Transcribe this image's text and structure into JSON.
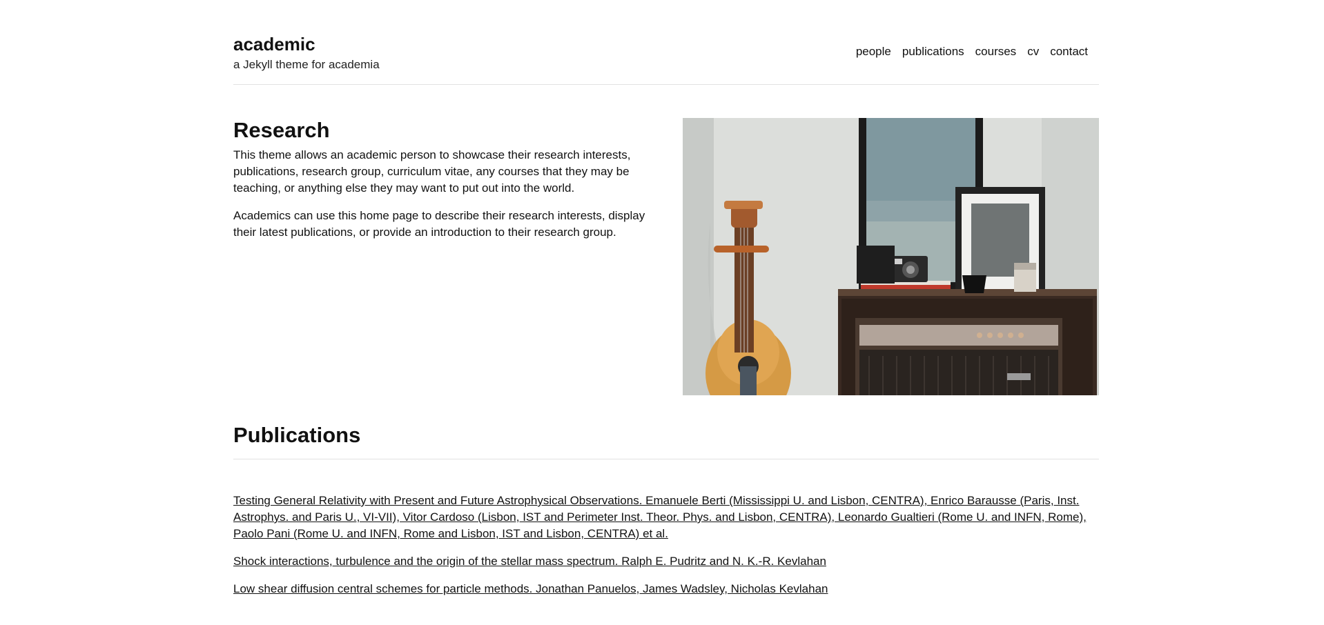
{
  "site": {
    "title": "academic",
    "tagline": "a Jekyll theme for academia",
    "nav": [
      "people",
      "publications",
      "courses",
      "cv",
      "contact"
    ]
  },
  "research": {
    "heading": "Research",
    "paragraphs": [
      "This theme allows an academic person to showcase their research interests, publications, research group, curriculum vitae, any courses that they may be teaching, or anything else they may want to put out into the world.",
      "Academics can use this home page to describe their research interests, display their latest publications, or provide an introduction to their research group."
    ]
  },
  "publications": {
    "heading": "Publications",
    "items": [
      "Testing General Relativity with Present and Future Astrophysical Observations. Emanuele Berti (Mississippi U. and Lisbon, CENTRA), Enrico Barausse (Paris, Inst. Astrophys. and Paris U., VI-VII), Vitor Cardoso (Lisbon, IST and Perimeter Inst. Theor. Phys. and Lisbon, CENTRA), Leonardo Gualtieri (Rome U. and INFN, Rome), Paolo Pani (Rome U. and INFN, Rome and Lisbon, IST and Lisbon, CENTRA) et al.",
      "Shock interactions, turbulence and the origin of the stellar mass spectrum. Ralph E. Pudritz and N. K.-R. Kevlahan",
      "Low shear diffusion central schemes for particle methods. Jonathan Panuelos, James Wadsley, Nicholas Kevlahan"
    ]
  },
  "image": {
    "subject": "acoustic guitar leaning on wall beside wooden cabinet with vintage radio, camera, mug and framed pictures"
  }
}
